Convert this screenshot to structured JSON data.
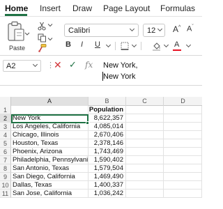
{
  "tabs": [
    "Home",
    "Insert",
    "Draw",
    "Page Layout",
    "Formulas"
  ],
  "ribbon": {
    "paste_label": "Paste",
    "font_name": "Calibri",
    "font_size": "12",
    "grow_font": "A^",
    "shrink_font": "Aˇ",
    "bold": "B",
    "italic": "I",
    "underline": "U",
    "font_color_letter": "A",
    "font_color": "#e81123"
  },
  "formula_bar": {
    "name_box": "A2",
    "fx": "fx",
    "content_line1": "New York,",
    "content_line2": "New York"
  },
  "grid": {
    "columns": [
      "A",
      "B",
      "C",
      "D"
    ],
    "selected_column": "A",
    "selected_row": "2",
    "rows": [
      {
        "num": "1",
        "a": "",
        "b": "Population"
      },
      {
        "num": "2",
        "a": "New York",
        "b": "8,622,357"
      },
      {
        "num": "3",
        "a": "Los Angeles, California",
        "b": "4,085,014"
      },
      {
        "num": "4",
        "a": "Chicago, Illinois",
        "b": "2,670,406"
      },
      {
        "num": "5",
        "a": "Houston, Texas",
        "b": "2,378,146"
      },
      {
        "num": "6",
        "a": "Phoenix, Arizona",
        "b": "1,743,469"
      },
      {
        "num": "7",
        "a": "Philadelphia, Pennsylvania",
        "b": "1,590,402"
      },
      {
        "num": "8",
        "a": "San Antonio, Texas",
        "b": "1,579,504"
      },
      {
        "num": "9",
        "a": "San Diego, California",
        "b": "1,469,490"
      },
      {
        "num": "10",
        "a": "Dallas, Texas",
        "b": "1,400,337"
      },
      {
        "num": "11",
        "a": "San Jose, California",
        "b": "1,036,242"
      }
    ]
  },
  "colors": {
    "accent": "#1f7244",
    "cancel": "#d13438"
  }
}
